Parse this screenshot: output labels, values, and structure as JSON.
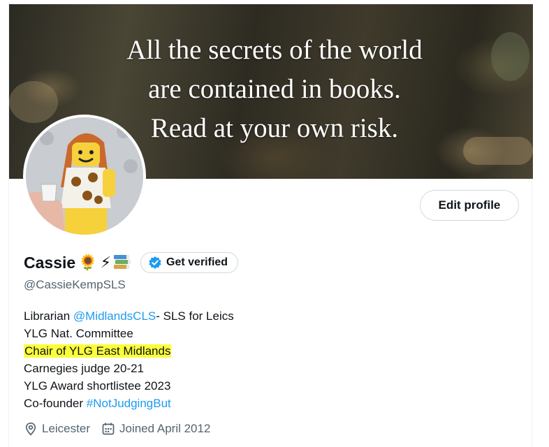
{
  "banner": {
    "lines": [
      "All the secrets of the world",
      "are contained in books.",
      "Read at your own risk."
    ]
  },
  "profile": {
    "display_name": "Cassie",
    "emoji": {
      "sunflower": "🌻",
      "bolt": "⚡",
      "books": "books-icon"
    },
    "handle": "@CassieKempSLS",
    "edit_button": "Edit profile",
    "verify_button": "Get verified"
  },
  "bio": {
    "line1_prefix": "Librarian ",
    "line1_link": "@MidlandsCLS",
    "line1_suffix": "- SLS for Leics",
    "line2": "YLG Nat. Committee",
    "line3": "Chair of YLG East Midlands",
    "line4": "Carnegies judge 20-21",
    "line5": "YLG Award shortlistee 2023",
    "line6_prefix": "Co-founder ",
    "line6_link": "#NotJudgingBut"
  },
  "meta": {
    "location": "Leicester",
    "location_icon": "location-pin-icon",
    "joined": "Joined April 2012",
    "joined_icon": "calendar-icon"
  },
  "colors": {
    "link": "#1d9bf0",
    "highlight": "#fbff3a",
    "secondary_text": "#536471",
    "verified_badge": "#1d9bf0"
  }
}
